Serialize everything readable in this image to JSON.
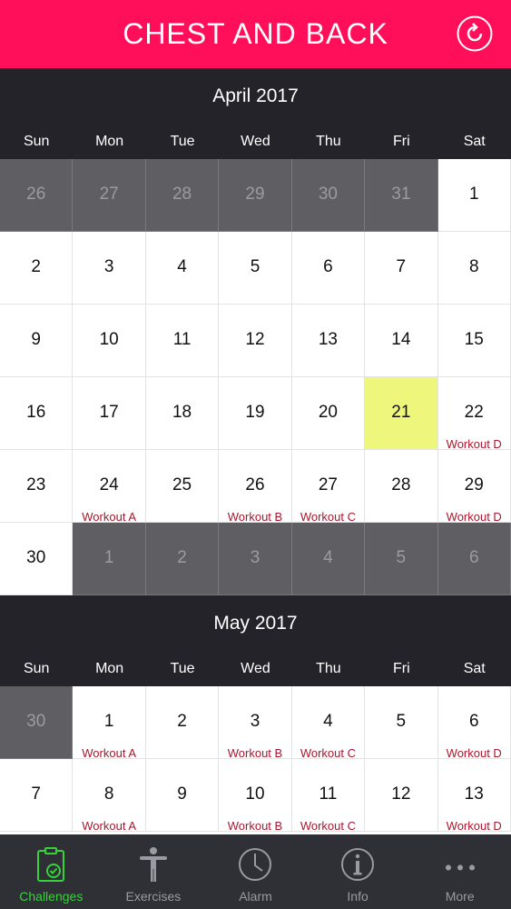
{
  "header": {
    "title": "CHEST AND BACK"
  },
  "weekday_names": [
    "Sun",
    "Mon",
    "Tue",
    "Wed",
    "Thu",
    "Fri",
    "Sat"
  ],
  "months": [
    {
      "title": "April 2017",
      "weeks": [
        [
          {
            "day": "26",
            "outside": true
          },
          {
            "day": "27",
            "outside": true
          },
          {
            "day": "28",
            "outside": true
          },
          {
            "day": "29",
            "outside": true
          },
          {
            "day": "30",
            "outside": true
          },
          {
            "day": "31",
            "outside": true
          },
          {
            "day": "1"
          }
        ],
        [
          {
            "day": "2"
          },
          {
            "day": "3"
          },
          {
            "day": "4"
          },
          {
            "day": "5"
          },
          {
            "day": "6"
          },
          {
            "day": "7"
          },
          {
            "day": "8"
          }
        ],
        [
          {
            "day": "9"
          },
          {
            "day": "10"
          },
          {
            "day": "11"
          },
          {
            "day": "12"
          },
          {
            "day": "13"
          },
          {
            "day": "14"
          },
          {
            "day": "15"
          }
        ],
        [
          {
            "day": "16"
          },
          {
            "day": "17"
          },
          {
            "day": "18"
          },
          {
            "day": "19"
          },
          {
            "day": "20"
          },
          {
            "day": "21",
            "highlight": true
          },
          {
            "day": "22",
            "workout": "Workout D"
          }
        ],
        [
          {
            "day": "23"
          },
          {
            "day": "24",
            "workout": "Workout A"
          },
          {
            "day": "25"
          },
          {
            "day": "26",
            "workout": "Workout B"
          },
          {
            "day": "27",
            "workout": "Workout C"
          },
          {
            "day": "28"
          },
          {
            "day": "29",
            "workout": "Workout D"
          }
        ],
        [
          {
            "day": "30"
          },
          {
            "day": "1",
            "outside": true
          },
          {
            "day": "2",
            "outside": true
          },
          {
            "day": "3",
            "outside": true
          },
          {
            "day": "4",
            "outside": true
          },
          {
            "day": "5",
            "outside": true
          },
          {
            "day": "6",
            "outside": true
          }
        ]
      ]
    },
    {
      "title": "May 2017",
      "weeks": [
        [
          {
            "day": "30",
            "outside": true
          },
          {
            "day": "1",
            "workout": "Workout A"
          },
          {
            "day": "2"
          },
          {
            "day": "3",
            "workout": "Workout B"
          },
          {
            "day": "4",
            "workout": "Workout C"
          },
          {
            "day": "5"
          },
          {
            "day": "6",
            "workout": "Workout D"
          }
        ],
        [
          {
            "day": "7"
          },
          {
            "day": "8",
            "workout": "Workout A"
          },
          {
            "day": "9"
          },
          {
            "day": "10",
            "workout": "Workout B"
          },
          {
            "day": "11",
            "workout": "Workout C"
          },
          {
            "day": "12"
          },
          {
            "day": "13",
            "workout": "Workout D"
          }
        ]
      ]
    }
  ],
  "tabbar": {
    "items": [
      {
        "label": "Challenges",
        "icon": "clipboard-check-icon",
        "active": true
      },
      {
        "label": "Exercises",
        "icon": "person-icon"
      },
      {
        "label": "Alarm",
        "icon": "clock-icon"
      },
      {
        "label": "Info",
        "icon": "info-icon"
      },
      {
        "label": "More",
        "icon": "more-dots-icon"
      }
    ]
  },
  "colors": {
    "header_bg": "#ff0f5a",
    "calendar_header_bg": "#232329",
    "outside_day_bg": "#5f5f63",
    "highlight_day_bg": "#eef77c",
    "workout_text": "#a8182e",
    "tab_active": "#36d43a",
    "tabbar_bg": "#2f2f36"
  }
}
